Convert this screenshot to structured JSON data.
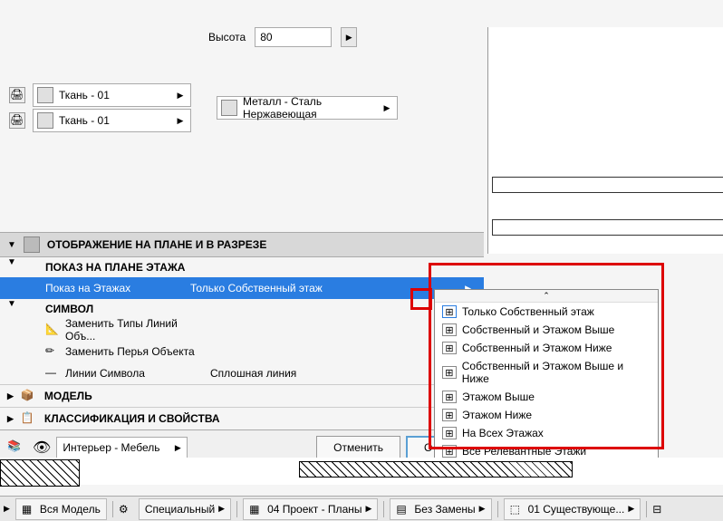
{
  "top": {
    "height_label": "Высота",
    "height_value": "80"
  },
  "materials": {
    "fabric1": "Ткань - 01",
    "fabric2": "Ткань - 01",
    "metal": "Металл - Сталь Нержавеющая"
  },
  "sections": {
    "display": "ОТОБРАЖЕНИЕ НА ПЛАНЕ И В РАЗРЕЗЕ",
    "floor_plan": "ПОКАЗ НА ПЛАНЕ ЭТАЖА",
    "story_label": "Показ на Этажах",
    "story_value": "Только Собственный этаж",
    "symbol": "СИМВОЛ",
    "replace_line_types": "Заменить Типы Линий Объ...",
    "replace_object_pens": "Заменить Перья Объекта",
    "symbol_lines": "Линии Символа",
    "symbol_lines_val": "Сплошная линия",
    "model": "МОДЕЛЬ",
    "classification": "КЛАССИФИКАЦИЯ И СВОЙСТВА"
  },
  "bottom": {
    "layer": "Интерьер - Мебель",
    "cancel": "Отменить",
    "ok": "О"
  },
  "dropdown": [
    "Только Собственный этаж",
    "Собственный и Этажом Выше",
    "Собственный и Этажом Ниже",
    "Собственный и Этажом Выше и Ниже",
    "Этажом Выше",
    "Этажом Ниже",
    "На Всех Этажах",
    "Все Релевантные Этажи"
  ],
  "tabs": {
    "all_model": "Вся Модель",
    "special": "Специальный",
    "project_plans": "04 Проект - Планы",
    "no_replace": "Без Замены",
    "existing": "01 Существующе..."
  }
}
